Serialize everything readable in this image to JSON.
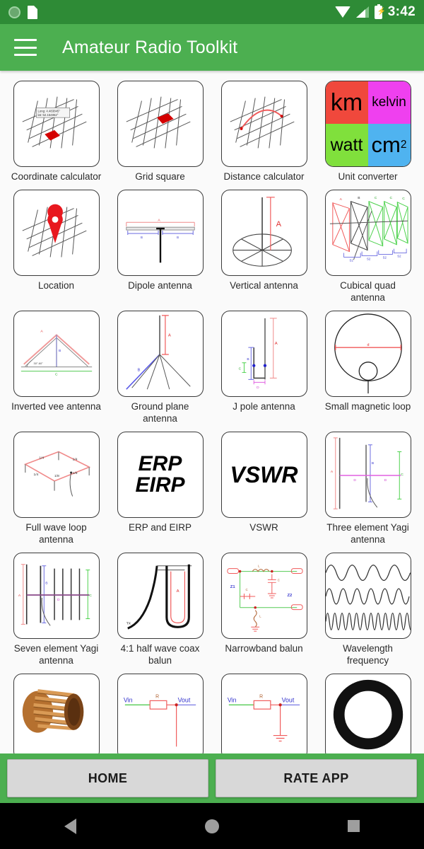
{
  "status_bar": {
    "time": "3:42",
    "icons": [
      "sync-icon",
      "sd-card-icon",
      "wifi-icon",
      "cell-signal-icon",
      "battery-charging-icon"
    ]
  },
  "app_bar": {
    "menu_icon": "hamburger-menu-icon",
    "title": "Amateur Radio Toolkit"
  },
  "grid": {
    "items": [
      {
        "label": "Coordinate calculator",
        "icon": "grid-map-coordinate-icon",
        "annotations": [
          "Long: 4.483845°",
          "lat: 52.154862°"
        ]
      },
      {
        "label": "Grid square",
        "icon": "grid-map-square-icon"
      },
      {
        "label": "Distance calculator",
        "icon": "grid-map-arc-icon"
      },
      {
        "label": "Unit converter",
        "icon": "unit-quadrants-icon",
        "quadrants": [
          {
            "text": "km",
            "color": "#f0483c"
          },
          {
            "text": "kelvin",
            "color": "#ef40ef"
          },
          {
            "text": "watt",
            "color": "#80e03c"
          },
          {
            "text": "cm",
            "sup": "2",
            "color": "#4fb3f0"
          }
        ]
      },
      {
        "label": "Location",
        "icon": "map-pin-icon"
      },
      {
        "label": "Dipole antenna",
        "icon": "dipole-antenna-icon",
        "annotations": [
          "A",
          "B",
          "B"
        ]
      },
      {
        "label": "Vertical antenna",
        "icon": "vertical-antenna-icon",
        "annotations": [
          "A"
        ]
      },
      {
        "label": "Cubical quad antenna",
        "icon": "cubical-quad-antenna-icon",
        "annotations": [
          "A",
          "B",
          "C",
          "C",
          "C",
          "S1",
          "S2",
          "S2",
          "S2"
        ]
      },
      {
        "label": "Inverted vee antenna",
        "icon": "inverted-vee-antenna-icon",
        "annotations": [
          "A",
          "B",
          "C",
          "30°-60°"
        ]
      },
      {
        "label": "Ground plane antenna",
        "icon": "ground-plane-antenna-icon",
        "annotations": [
          "A",
          "B"
        ]
      },
      {
        "label": "J pole antenna",
        "icon": "j-pole-antenna-icon",
        "annotations": [
          "A",
          "B",
          "C",
          "D"
        ]
      },
      {
        "label": "Small magnetic loop",
        "icon": "small-magnetic-loop-icon",
        "annotations": [
          "d"
        ]
      },
      {
        "label": "Full wave loop antenna",
        "icon": "full-wave-loop-antenna-icon",
        "annotations": [
          "1/4",
          "1/4",
          "1/4",
          "1/8",
          "1/8"
        ]
      },
      {
        "label": "ERP and EIRP",
        "icon": "erp-eirp-text-icon",
        "text_lines": [
          "ERP",
          "EIRP"
        ]
      },
      {
        "label": "VSWR",
        "icon": "vswr-text-icon",
        "text_lines": [
          "VSWR"
        ]
      },
      {
        "label": "Three element Yagi antenna",
        "icon": "three-element-yagi-icon",
        "annotations": [
          "A",
          "B",
          "C",
          "D",
          "D"
        ]
      },
      {
        "label": "Seven element Yagi antenna",
        "icon": "seven-element-yagi-icon",
        "annotations": [
          "A",
          "B",
          "C",
          "D"
        ]
      },
      {
        "label": "4:1 half wave coax balun",
        "icon": "half-wave-coax-balun-icon",
        "annotations": [
          "TX",
          "A"
        ]
      },
      {
        "label": "Narrowband balun",
        "icon": "narrowband-balun-icon",
        "annotations": [
          "Z1",
          "Z2",
          "L",
          "C",
          "C",
          "L"
        ]
      },
      {
        "label": "Wavelength frequency",
        "icon": "sine-waves-icon"
      },
      {
        "label": "",
        "icon": "copper-coil-icon"
      },
      {
        "label": "",
        "icon": "voltage-divider-icon",
        "annotations": [
          "Vin",
          "R",
          "Vout"
        ]
      },
      {
        "label": "",
        "icon": "voltage-divider-ground-icon",
        "annotations": [
          "Vin",
          "R",
          "Vout"
        ]
      },
      {
        "label": "",
        "icon": "toroid-icon"
      }
    ]
  },
  "bottom_bar": {
    "home_label": "HOME",
    "rate_label": "RATE APP"
  },
  "nav_bar": {
    "back": "back-triangle-icon",
    "home": "home-circle-icon",
    "recents": "recents-square-icon"
  },
  "colors": {
    "status_bar": "#2e8b36",
    "app_bar": "#4caf50",
    "page_background": "#fafafa",
    "tile_border": "#3a3a3a",
    "button_face": "#d8d8d8",
    "accent_red": "#f05a5a",
    "accent_blue": "#5a5ae8",
    "accent_green": "#55cc55",
    "accent_magenta": "#e060e0"
  }
}
